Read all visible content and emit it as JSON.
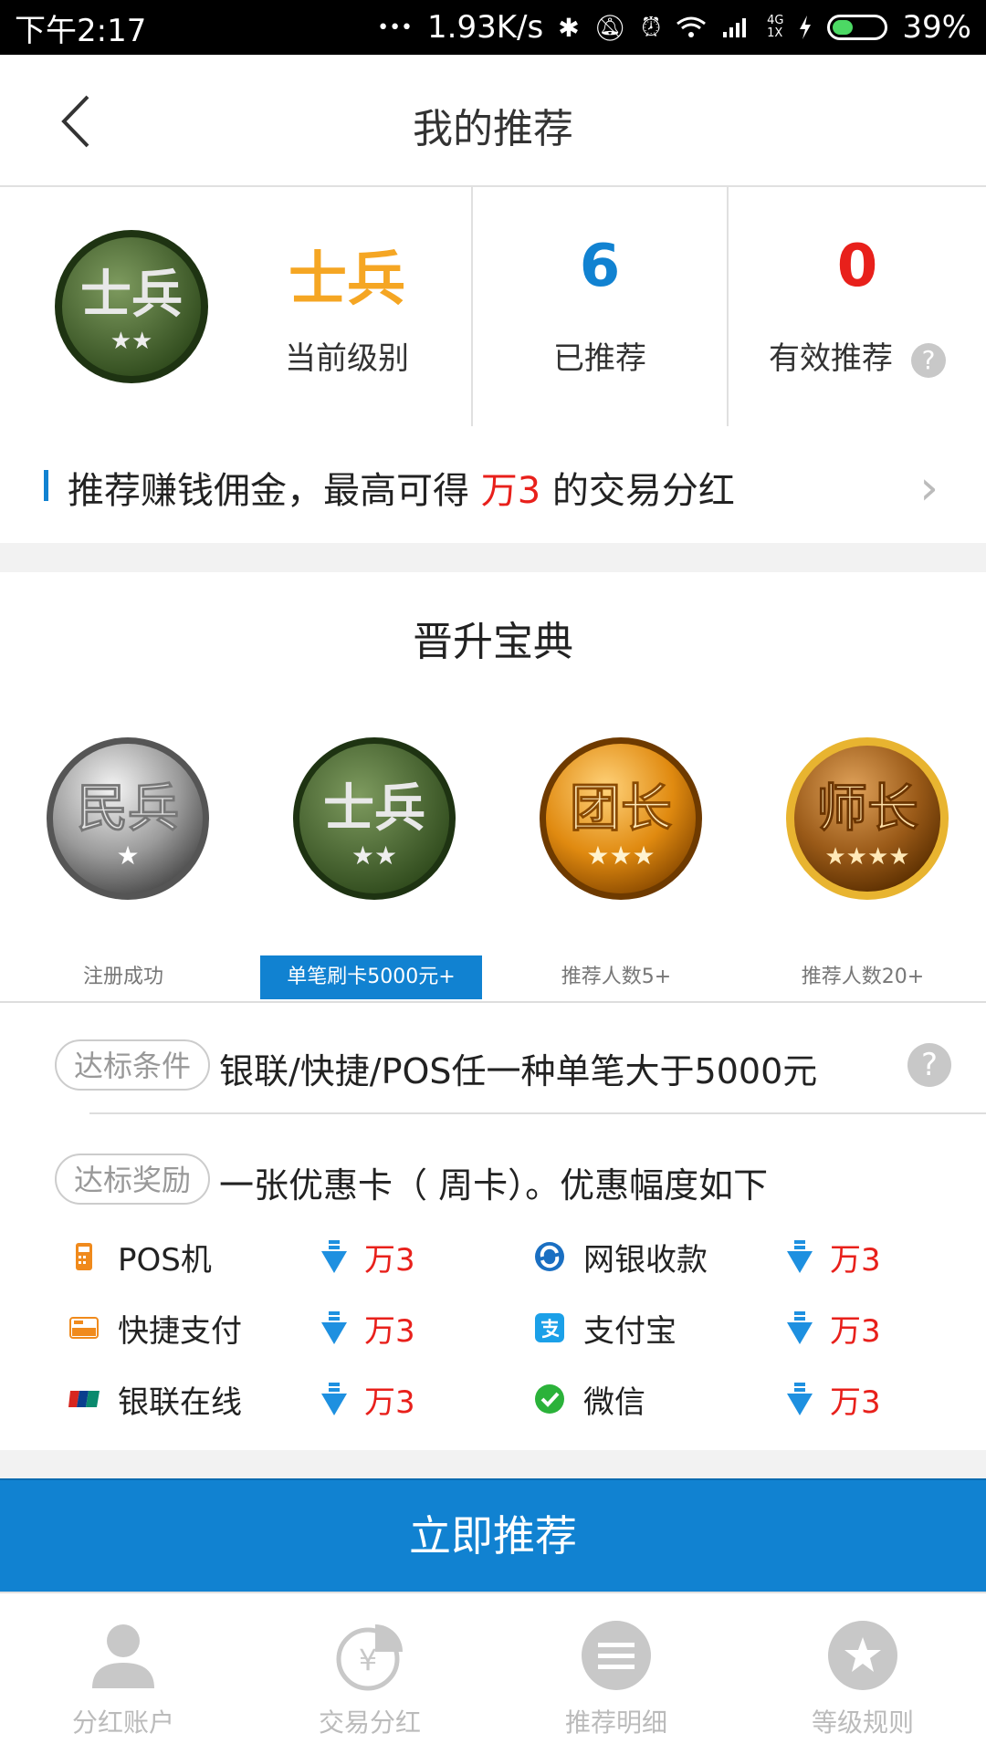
{
  "status_bar": {
    "time": "下午2:17",
    "dots": "•••",
    "speed": "1.93K/s",
    "net_label_top": "4G",
    "net_label_bottom": "1X",
    "battery": "39%",
    "icons": [
      "bluetooth-icon",
      "mute-icon",
      "alarm-icon",
      "wifi-icon",
      "signal-icon",
      "charging-icon",
      "battery-icon"
    ]
  },
  "nav": {
    "title": "我的推荐",
    "back_icon": "back-chevron-icon"
  },
  "stats": {
    "level_value": "士兵",
    "level_label": "当前级别",
    "recommended_value": "6",
    "recommended_label": "已推荐",
    "valid_value": "0",
    "valid_label": "有效推荐",
    "help": "?",
    "colors": {
      "level": "#f5a623",
      "recommended": "#1182d1",
      "valid": "#e8201b"
    }
  },
  "promo": {
    "text_before": "推荐赚钱佣金，最高可得 ",
    "highlight": "万3",
    "text_after": " 的交易分红",
    "arrow": "›"
  },
  "guide": {
    "title": "晋升宝典",
    "medals": [
      {
        "name": "民兵",
        "stars": "★"
      },
      {
        "name": "士兵",
        "stars": "★★"
      },
      {
        "name": "团长",
        "stars": "★★★"
      },
      {
        "name": "师长",
        "stars": "★★★★"
      }
    ],
    "tabs": [
      {
        "label": "注册成功",
        "active": false
      },
      {
        "label": "单笔刷卡5000元+",
        "active": true
      },
      {
        "label": "推荐人数5+",
        "active": false
      },
      {
        "label": "推荐人数20+",
        "active": false
      }
    ],
    "condition": {
      "tag": "达标条件",
      "text": "银联/快捷/POS任一种单笔大于5000元",
      "help": "?"
    },
    "reward": {
      "tag": "达标奖励",
      "text": "一张优惠卡（ 周卡）。优惠幅度如下"
    },
    "rates": [
      {
        "name": "POS机",
        "value": "万3",
        "icon": "pos-machine-icon"
      },
      {
        "name": "网银收款",
        "value": "万3",
        "icon": "online-bank-icon"
      },
      {
        "name": "快捷支付",
        "value": "万3",
        "icon": "quick-pay-icon"
      },
      {
        "name": "支付宝",
        "value": "万3",
        "icon": "alipay-icon"
      },
      {
        "name": "银联在线",
        "value": "万3",
        "icon": "unionpay-icon"
      },
      {
        "name": "微信",
        "value": "万3",
        "icon": "wechat-icon"
      }
    ]
  },
  "cta": {
    "label": "立即推荐"
  },
  "tabbar": [
    {
      "label": "分红账户",
      "icon": "user-icon"
    },
    {
      "label": "交易分红",
      "icon": "yuan-chart-icon"
    },
    {
      "label": "推荐明细",
      "icon": "list-icon"
    },
    {
      "label": "等级规则",
      "icon": "star-icon"
    }
  ]
}
